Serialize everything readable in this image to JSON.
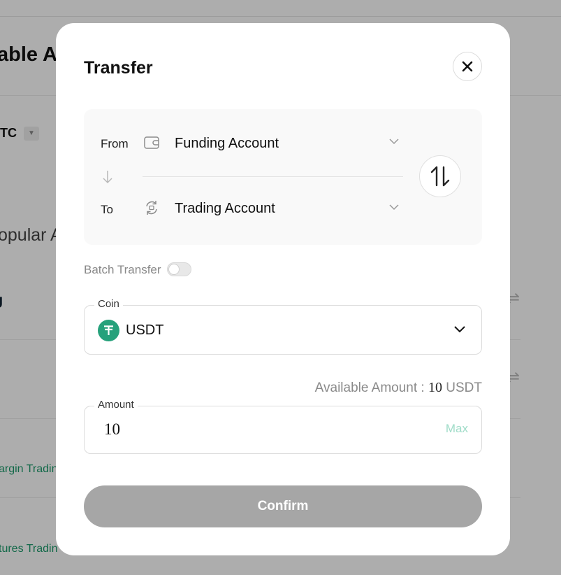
{
  "background": {
    "title": "able As",
    "coin": "TC",
    "popular": "opular A",
    "mark": "J",
    "links": [
      "argin Tradin",
      "tures Tradin"
    ]
  },
  "modal": {
    "title": "Transfer",
    "from_label": "From",
    "from_account": "Funding Account",
    "to_label": "To",
    "to_account": "Trading Account",
    "batch_transfer_label": "Batch Transfer",
    "batch_transfer_enabled": false,
    "coin_legend": "Coin",
    "coin_value": "USDT",
    "available_label": "Available Amount :",
    "available_value": "10",
    "available_unit": "USDT",
    "amount_legend": "Amount",
    "amount_value": "10",
    "max_label": "Max",
    "confirm_label": "Confirm"
  },
  "colors": {
    "usdt_brand": "#26a17b",
    "max_accent": "#9fdcc8",
    "confirm_disabled": "#a6a6a6",
    "link_green": "#1a9a6a"
  },
  "icons": {
    "close": "close-icon",
    "from": "wallet-icon",
    "to": "exchange-cycle-icon",
    "swap": "swap-vertical-icon",
    "direction": "arrow-down-icon",
    "dropdown": "chevron-down-icon",
    "coin": "tether-icon"
  }
}
